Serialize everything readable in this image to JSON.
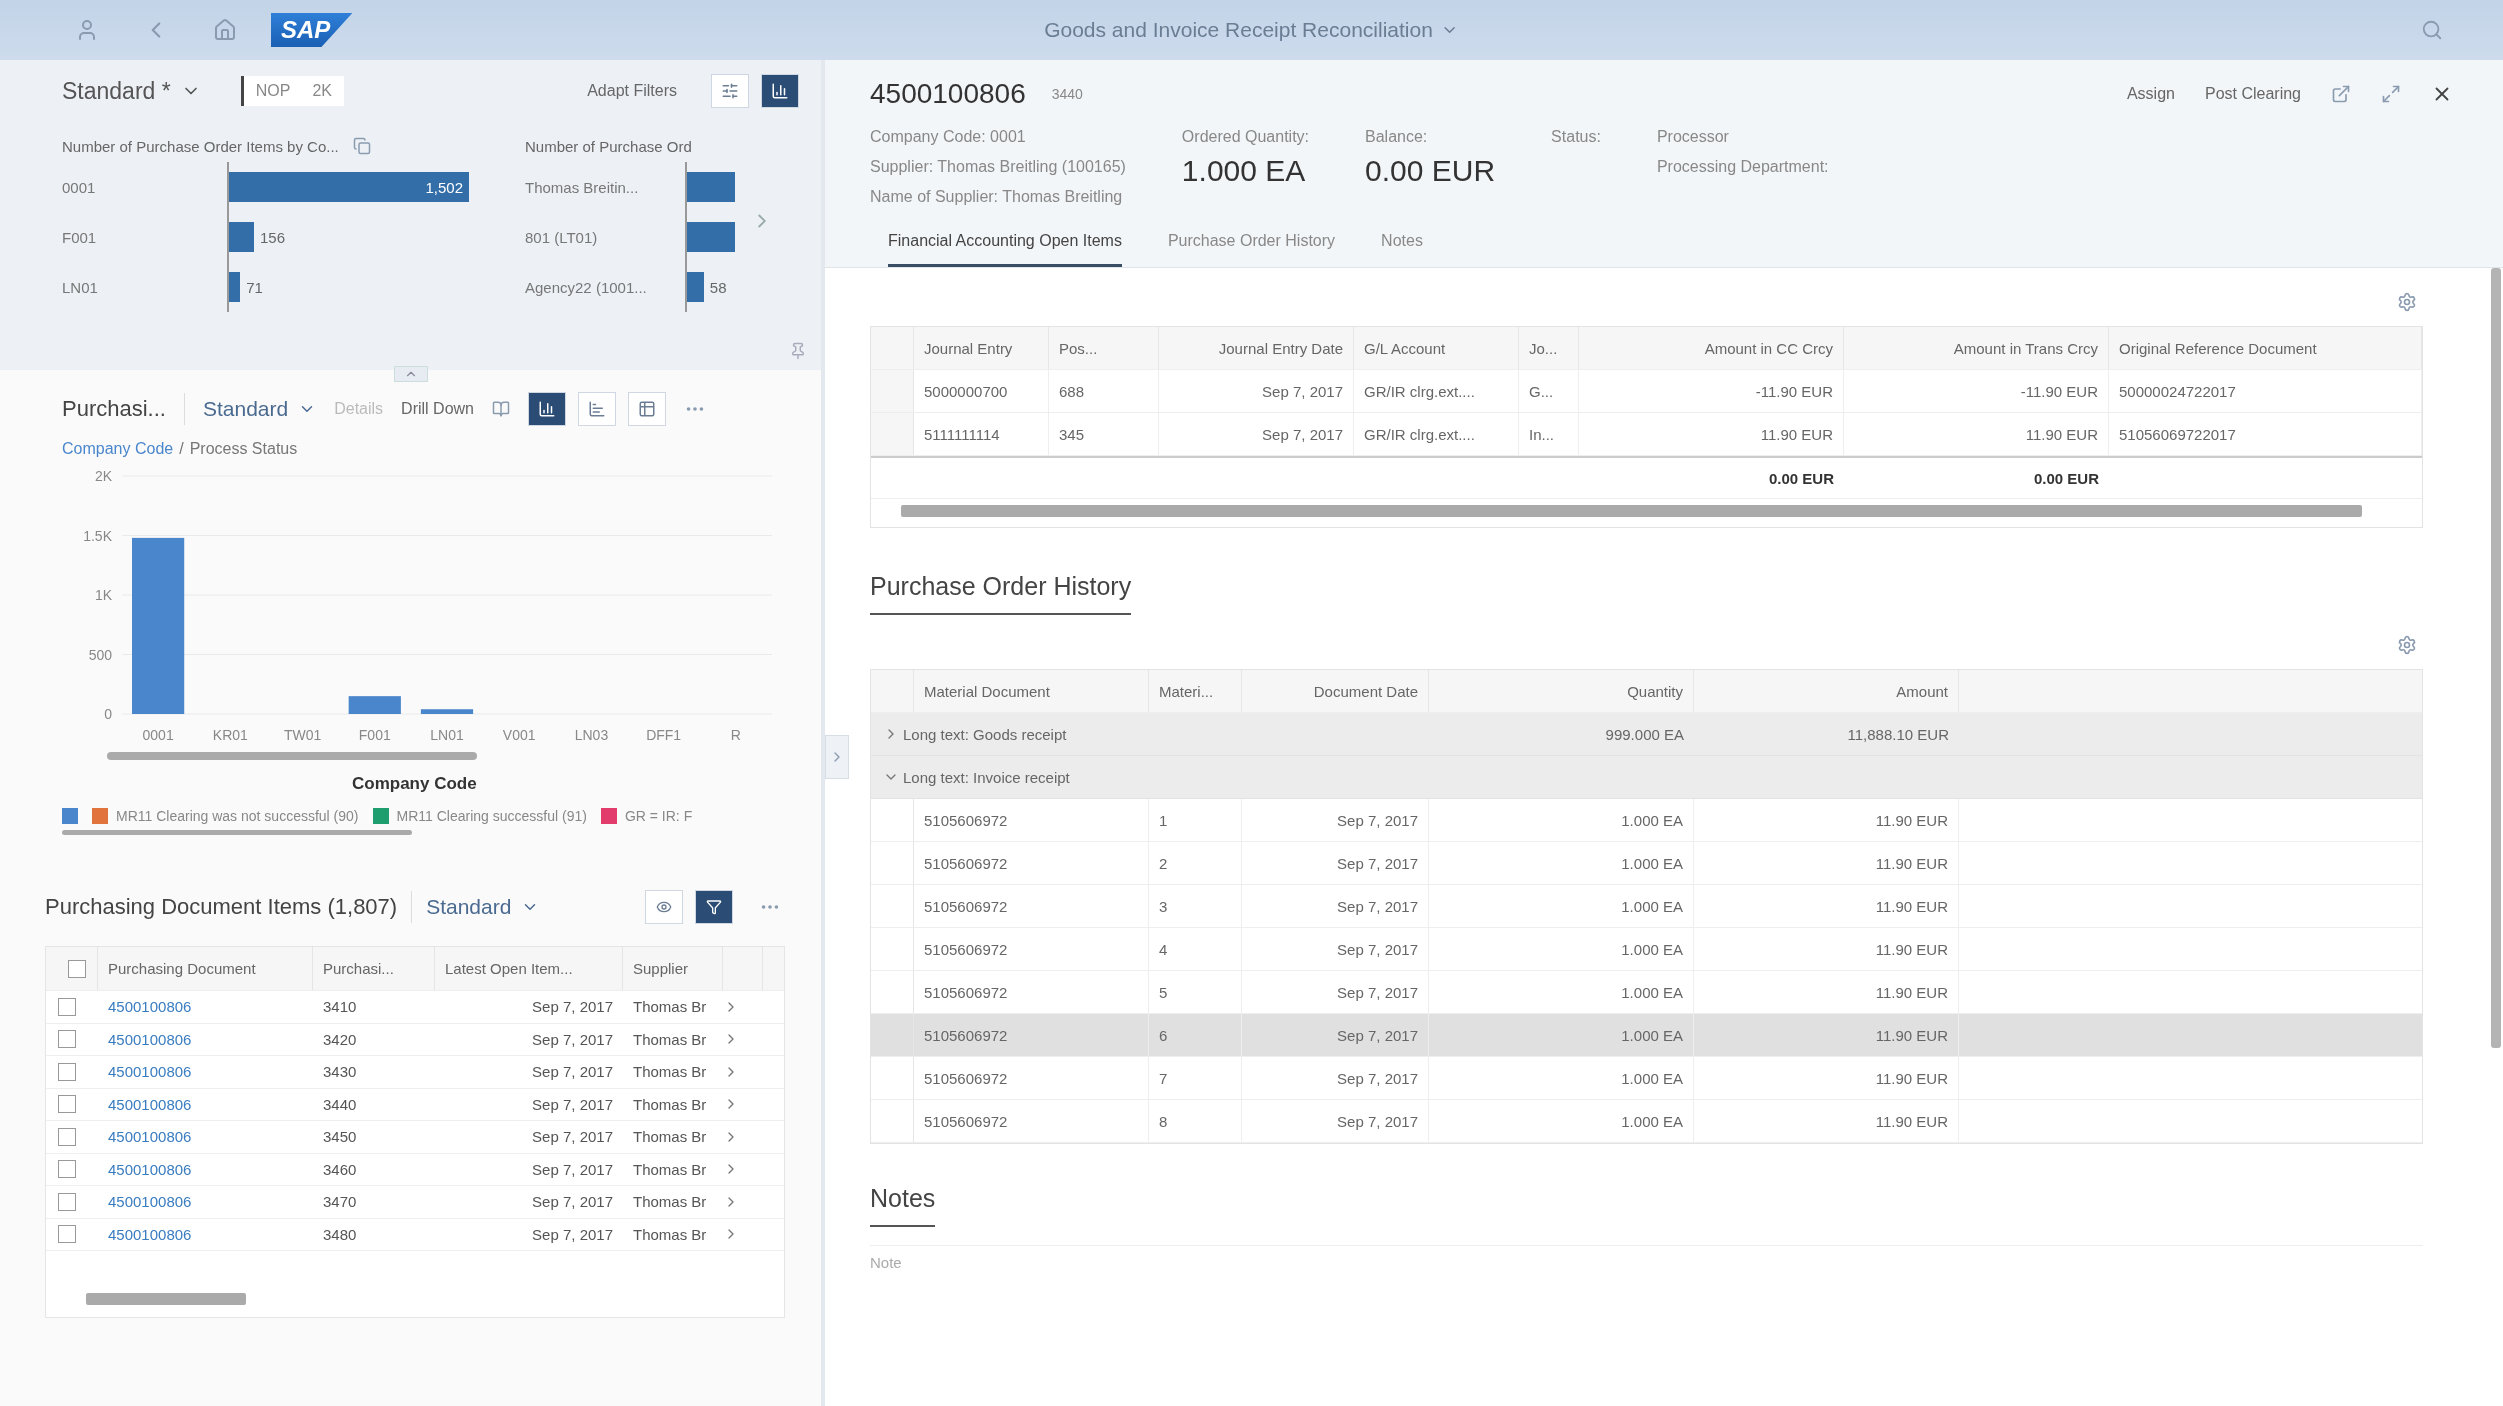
{
  "shell": {
    "logo": "SAP",
    "title": "Goods and Invoice Receipt Reconciliation"
  },
  "filter_bar": {
    "variant": "Standard *",
    "chip_texts": [
      "NOP",
      "2K"
    ],
    "adapt_filters": "Adapt Filters",
    "view_toggle": [
      {
        "kind": "list",
        "selected": false
      },
      {
        "kind": "chart",
        "selected": true
      }
    ]
  },
  "mini_charts": [
    {
      "title": "Number of Purchase Order Items by Co...",
      "bars": [
        {
          "label": "0001",
          "value": "1,502",
          "level": 1
        },
        {
          "label": "F001",
          "value": "156",
          "level": 0.104
        },
        {
          "label": "LN01",
          "value": "71",
          "level": 0.047
        }
      ]
    },
    {
      "title": "Number of Purchase Ord",
      "bars": [
        {
          "label": "Thomas Breitin...",
          "level": 1
        },
        {
          "label": "801 (LT01)",
          "level": 1
        },
        {
          "label": "Agency22 (1001...",
          "value": "58",
          "level": 0.35
        }
      ]
    }
  ],
  "chart_card": {
    "title": "Purchasi...",
    "variant": "Standard",
    "actions": [
      {
        "label": "Details",
        "disabled": true
      },
      {
        "label": "Drill Down",
        "disabled": false
      }
    ],
    "chart_types": [
      {
        "kind": "column",
        "selected": true
      },
      {
        "kind": "bar",
        "selected": false
      },
      {
        "kind": "table",
        "selected": false
      }
    ],
    "breadcrumb": {
      "link": "Company Code",
      "separator": "/",
      "current": "Process Status"
    },
    "chart_data": {
      "type": "bar",
      "grid": true,
      "xlabel": "Company Code",
      "categories": [
        "0001",
        "KR01",
        "TW01",
        "F001",
        "LN01",
        "V001",
        "LN03",
        "DFF1",
        "R"
      ],
      "values": [
        1480,
        0,
        0,
        150,
        40,
        0,
        0,
        0,
        0
      ],
      "ylim": [
        0,
        2000
      ],
      "yticks": [
        {
          "value": 0,
          "label": "0"
        },
        {
          "value": 500,
          "label": "500"
        },
        {
          "value": 1000,
          "label": "1K"
        },
        {
          "value": 1500,
          "label": "1.5K"
        },
        {
          "value": 2000,
          "label": "2K"
        }
      ]
    },
    "legend": [
      {
        "color": "#4a86cc"
      },
      {
        "color": "#e0743c",
        "label": "MR11 Clearing was not successful (90)"
      },
      {
        "color": "#1e9e6e",
        "label": "MR11 Clearing successful (91)"
      },
      {
        "color": "#e23c6c",
        "label": "GR = IR: F"
      }
    ]
  },
  "table": {
    "title": "Purchasing Document Items (1,807)",
    "variant": "Standard",
    "toggles": [
      {
        "kind": "eye",
        "selected": false
      },
      {
        "kind": "filter",
        "selected": true
      }
    ],
    "select_all": {
      "checked": false
    },
    "columns": [
      "Purchasing Document",
      "Purchasi...",
      "Latest Open Item...",
      "Supplier"
    ],
    "rows": [
      {
        "checked": false,
        "cells": [
          "4500100806",
          "3410",
          "Sep 7, 2017",
          "Thomas Br"
        ]
      },
      {
        "checked": false,
        "cells": [
          "4500100806",
          "3420",
          "Sep 7, 2017",
          "Thomas Br"
        ]
      },
      {
        "checked": false,
        "cells": [
          "4500100806",
          "3430",
          "Sep 7, 2017",
          "Thomas Br"
        ]
      },
      {
        "checked": false,
        "cells": [
          "4500100806",
          "3440",
          "Sep 7, 2017",
          "Thomas Br"
        ]
      },
      {
        "checked": false,
        "cells": [
          "4500100806",
          "3450",
          "Sep 7, 2017",
          "Thomas Br"
        ]
      },
      {
        "checked": false,
        "cells": [
          "4500100806",
          "3460",
          "Sep 7, 2017",
          "Thomas Br"
        ]
      },
      {
        "checked": false,
        "cells": [
          "4500100806",
          "3470",
          "Sep 7, 2017",
          "Thomas Br"
        ]
      },
      {
        "checked": false,
        "cells": [
          "4500100806",
          "3480",
          "Sep 7, 2017",
          "Thomas Br"
        ]
      }
    ]
  },
  "detail": {
    "title": "4500100806",
    "subtitle": "3440",
    "actions": [
      "Assign",
      "Post Clearing"
    ],
    "attributes": [
      {
        "label": "Company Code:",
        "value": "0001"
      },
      {
        "label": "Supplier:",
        "value": "Thomas Breitling (100165)"
      },
      {
        "label": "Name of Supplier:",
        "value": "Thomas Breitling"
      }
    ],
    "kpis": [
      {
        "label": "Ordered Quantity:",
        "value": "1.000 EA"
      },
      {
        "label": "Balance:",
        "value": "0.00  EUR"
      },
      {
        "label": "Status:"
      }
    ],
    "processor": [
      "Processor",
      "Processing Department:"
    ],
    "tabs": [
      {
        "label": "Financial Accounting Open Items",
        "selected": true
      },
      {
        "label": "Purchase Order History",
        "selected": false
      },
      {
        "label": "Notes",
        "selected": false
      }
    ]
  },
  "fi_table": {
    "columns": [
      "Journal Entry",
      "Pos...",
      "Journal Entry Date",
      "G/L Account",
      "Jo...",
      "Amount in CC Crcy",
      "Amount in Trans Crcy",
      "Original Reference Document"
    ],
    "rows": [
      [
        "5000000700",
        "688",
        "Sep 7, 2017",
        "GR/IR clrg.ext....",
        "G...",
        "-11.90  EUR",
        "-11.90  EUR",
        "50000024722017"
      ],
      [
        "5111111114",
        "345",
        "Sep 7, 2017",
        "GR/IR clrg.ext....",
        "In...",
        "11.90  EUR",
        "11.90  EUR",
        "51056069722017"
      ]
    ],
    "totals": {
      "cc": "0.00  EUR",
      "trans": "0.00  EUR"
    }
  },
  "po_history": {
    "title": "Purchase Order History",
    "columns": [
      "Material Document",
      "Materi...",
      "Document Date",
      "Quantity",
      "Amount"
    ],
    "groups": [
      {
        "label": "Long text: Goods receipt",
        "expanded": false,
        "quantity": "999.000  EA",
        "amount": "11,888.10  EUR"
      },
      {
        "label": "Long text: Invoice receipt",
        "expanded": true,
        "children": [
          {
            "selected": false,
            "cells": [
              "5105606972",
              "1",
              "Sep 7, 2017",
              "1.000  EA",
              "11.90  EUR"
            ]
          },
          {
            "selected": false,
            "cells": [
              "5105606972",
              "2",
              "Sep 7, 2017",
              "1.000  EA",
              "11.90  EUR"
            ]
          },
          {
            "selected": false,
            "cells": [
              "5105606972",
              "3",
              "Sep 7, 2017",
              "1.000  EA",
              "11.90  EUR"
            ]
          },
          {
            "selected": false,
            "cells": [
              "5105606972",
              "4",
              "Sep 7, 2017",
              "1.000  EA",
              "11.90  EUR"
            ]
          },
          {
            "selected": false,
            "cells": [
              "5105606972",
              "5",
              "Sep 7, 2017",
              "1.000  EA",
              "11.90  EUR"
            ]
          },
          {
            "selected": true,
            "cells": [
              "5105606972",
              "6",
              "Sep 7, 2017",
              "1.000  EA",
              "11.90  EUR"
            ]
          },
          {
            "selected": false,
            "cells": [
              "5105606972",
              "7",
              "Sep 7, 2017",
              "1.000  EA",
              "11.90  EUR"
            ]
          },
          {
            "selected": false,
            "cells": [
              "5105606972",
              "8",
              "Sep 7, 2017",
              "1.000  EA",
              "11.90  EUR"
            ]
          }
        ]
      }
    ]
  },
  "notes": {
    "title": "Notes",
    "placeholder": "Note"
  }
}
